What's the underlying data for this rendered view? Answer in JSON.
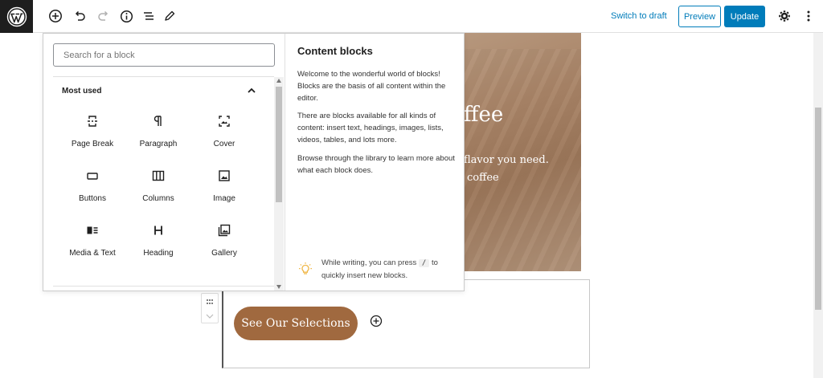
{
  "toolbar": {
    "switch_to_draft": "Switch to draft",
    "preview": "Preview",
    "update": "Update",
    "icons": [
      "wordpress-logo",
      "add-block-icon",
      "undo-icon",
      "redo-icon",
      "info-icon",
      "list-view-icon",
      "tools-pencil-icon",
      "settings-gear-icon",
      "more-options-icon"
    ]
  },
  "inserter": {
    "search_placeholder": "Search for a block",
    "section_title": "Most used",
    "blocks": [
      {
        "label": "Page Break",
        "icon": "page-break-icon"
      },
      {
        "label": "Paragraph",
        "icon": "paragraph-icon"
      },
      {
        "label": "Cover",
        "icon": "cover-icon"
      },
      {
        "label": "Buttons",
        "icon": "buttons-icon"
      },
      {
        "label": "Columns",
        "icon": "columns-icon"
      },
      {
        "label": "Image",
        "icon": "image-icon"
      },
      {
        "label": "Media & Text",
        "icon": "media-text-icon"
      },
      {
        "label": "Heading",
        "icon": "heading-icon"
      },
      {
        "label": "Gallery",
        "icon": "gallery-icon"
      }
    ],
    "help": {
      "title": "Content blocks",
      "p1": "Welcome to the wonderful world of blocks! Blocks are the basis of all content within the editor.",
      "p2": "There are blocks available for all kinds of content: insert text, headings, images, lists, videos, tables, and lots more.",
      "p3": "Browse through the library to learn more about what each block does.",
      "tip_before": "While writing, you can press ",
      "tip_key": "/",
      "tip_after": " to quickly insert new blocks."
    }
  },
  "canvas": {
    "cover_title_fragment": "ffee",
    "cover_line1_fragment": "flavor you need.",
    "cover_line2_fragment": "coffee",
    "button_label": "See Our Selections"
  },
  "colors": {
    "accent": "#007cba",
    "button_brown": "#a0693f",
    "dark": "#1e1e1e"
  }
}
